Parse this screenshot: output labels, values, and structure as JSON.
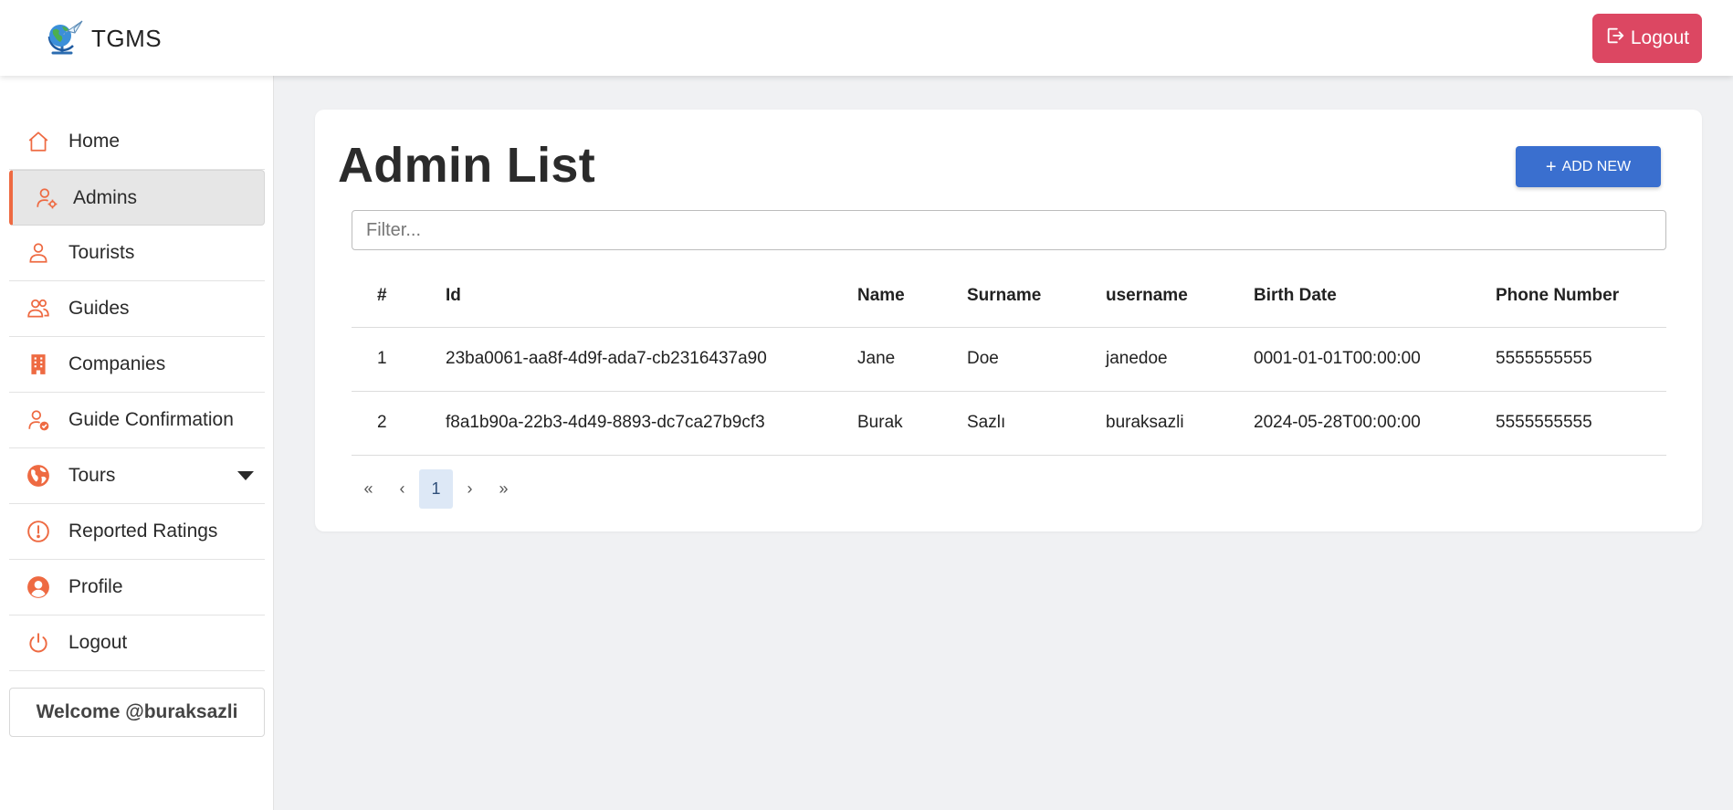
{
  "app": {
    "name": "TGMS"
  },
  "header": {
    "logout_label": "Logout"
  },
  "sidebar": {
    "items": [
      {
        "label": "Home",
        "icon": "home-icon",
        "active": false
      },
      {
        "label": "Admins",
        "icon": "user-gear-icon",
        "active": true
      },
      {
        "label": "Tourists",
        "icon": "user-icon",
        "active": false
      },
      {
        "label": "Guides",
        "icon": "users-icon",
        "active": false
      },
      {
        "label": "Companies",
        "icon": "building-icon",
        "active": false
      },
      {
        "label": "Guide Confirmation",
        "icon": "user-check-icon",
        "active": false
      },
      {
        "label": "Tours",
        "icon": "globe-icon",
        "active": false,
        "has_dropdown": true
      },
      {
        "label": "Reported Ratings",
        "icon": "exclamation-circle-icon",
        "active": false
      },
      {
        "label": "Profile",
        "icon": "user-circle-icon",
        "active": false
      },
      {
        "label": "Logout",
        "icon": "power-icon",
        "active": false
      }
    ],
    "welcome": "Welcome @buraksazli"
  },
  "main": {
    "title": "Admin List",
    "add_new_label": "ADD NEW",
    "filter_placeholder": "Filter...",
    "table": {
      "columns": [
        "#",
        "Id",
        "Name",
        "Surname",
        "username",
        "Birth Date",
        "Phone Number"
      ],
      "rows": [
        [
          "1",
          "23ba0061-aa8f-4d9f-ada7-cb2316437a90",
          "Jane",
          "Doe",
          "janedoe",
          "0001-01-01T00:00:00",
          "5555555555"
        ],
        [
          "2",
          "f8a1b90a-22b3-4d49-8893-dc7ca27b9cf3",
          "Burak",
          "Sazlı",
          "buraksazli",
          "2024-05-28T00:00:00",
          "5555555555"
        ]
      ]
    },
    "pagination": {
      "first": "«",
      "prev": "‹",
      "current": "1",
      "next": "›",
      "last": "»"
    }
  },
  "colors": {
    "accent": "#ee6a42",
    "logout": "#dc4762",
    "primary": "#3a6fcf"
  }
}
